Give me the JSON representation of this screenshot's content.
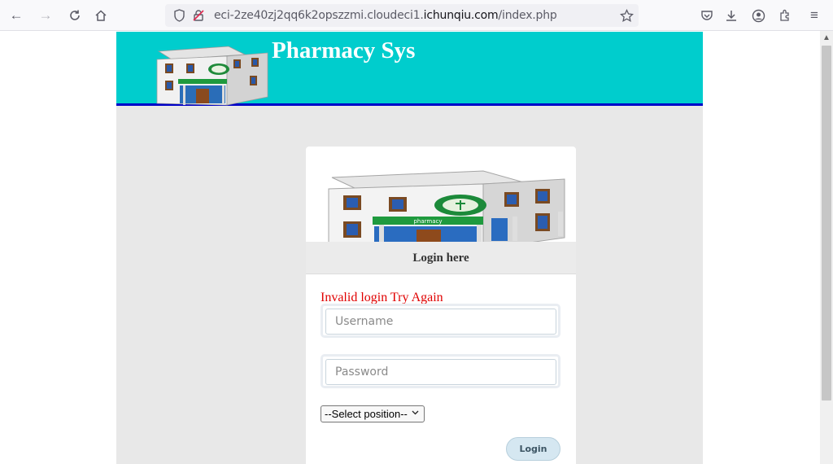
{
  "browser": {
    "url_prefix": "eci-2ze40zj2qq6k2opszzmi.cloudeci1.",
    "url_domain": "ichunqiu.com",
    "url_path": "/index.php"
  },
  "header": {
    "title": "Pharmacy Sys"
  },
  "login": {
    "heading": "Login here",
    "error": "Invalid login Try Again",
    "username_placeholder": "Username",
    "password_placeholder": "Password",
    "position_selected": "--Select position--",
    "submit_label": "Login"
  },
  "images": {
    "sign_text": "pharmacy"
  },
  "colors": {
    "header_bg": "#00cdcd",
    "header_border": "#0000c8",
    "error": "#e00000"
  }
}
